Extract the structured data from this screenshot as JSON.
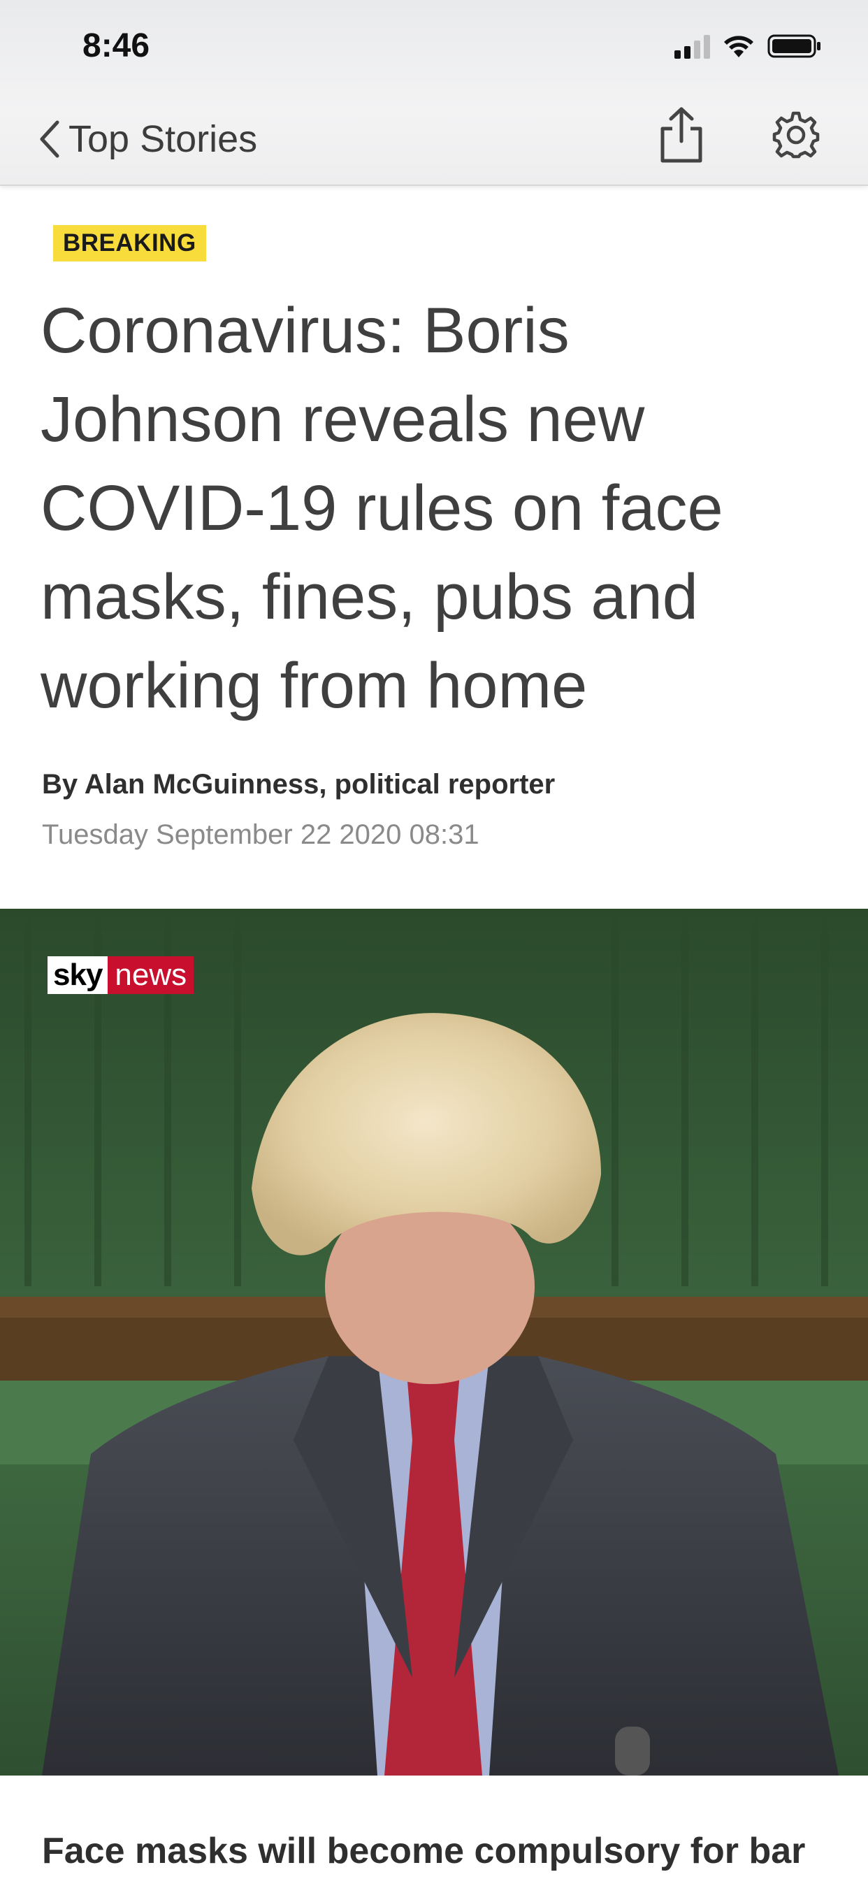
{
  "status_bar": {
    "time": "8:46"
  },
  "nav": {
    "back_label": "Top Stories"
  },
  "article": {
    "badge": "BREAKING",
    "headline": "Coronavirus: Boris Johnson reveals new COVID-19 rules on face masks, fines, pubs and working from home",
    "byline": "By Alan McGuinness, political reporter",
    "date": "Tuesday September 22 2020 08:31",
    "image": {
      "logo_text_sky": "sky",
      "logo_text_news": "news"
    },
    "lead_text": "Face masks will become compulsory for bar"
  },
  "colors": {
    "badge_bg": "#f7dc3c",
    "sky_news_red": "#c8102e",
    "commons_green": "#3c6a40"
  }
}
